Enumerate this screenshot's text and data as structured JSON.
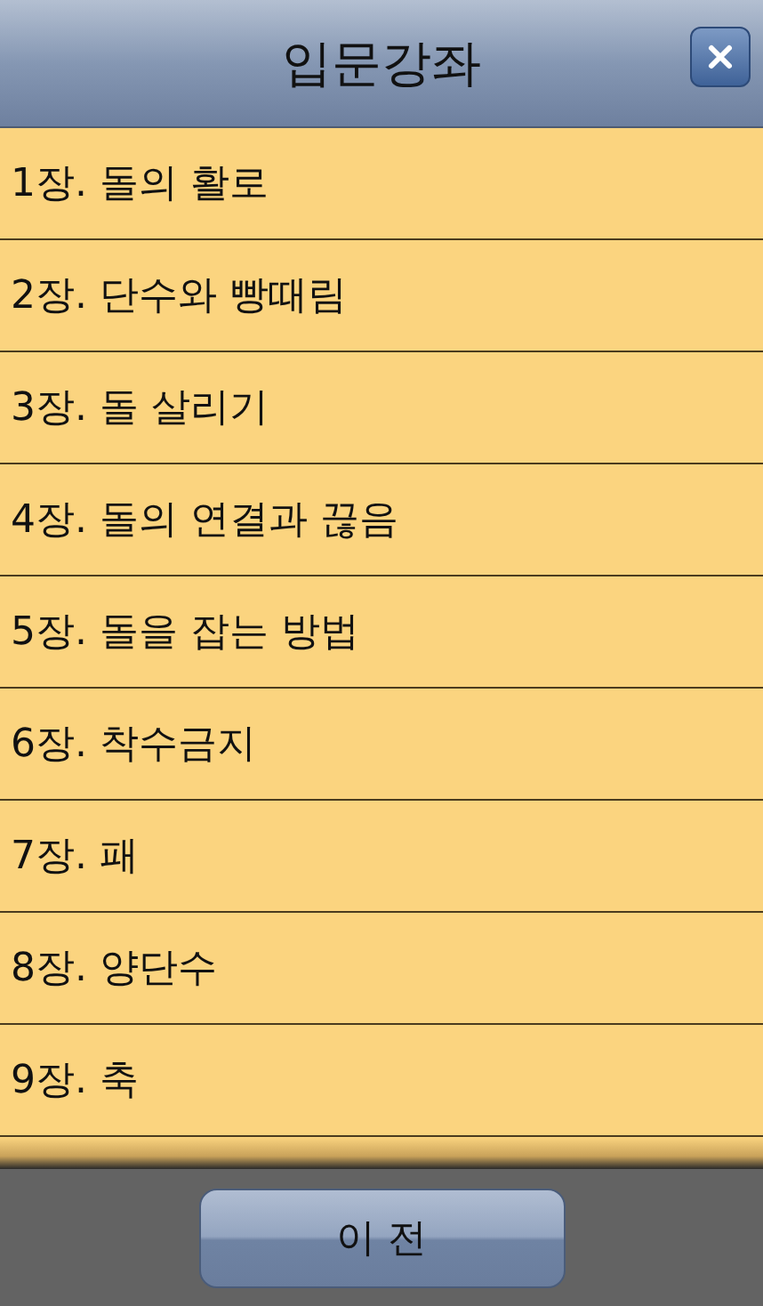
{
  "header": {
    "title": "입문강좌"
  },
  "chapters": [
    {
      "label": "1장. 돌의 활로"
    },
    {
      "label": "2장. 단수와 빵때림"
    },
    {
      "label": "3장. 돌 살리기"
    },
    {
      "label": "4장. 돌의 연결과 끊음"
    },
    {
      "label": "5장. 돌을 잡는 방법"
    },
    {
      "label": "6장. 착수금지"
    },
    {
      "label": "7장. 패"
    },
    {
      "label": "8장. 양단수"
    },
    {
      "label": "9장. 축"
    }
  ],
  "footer": {
    "button": "이 전"
  }
}
